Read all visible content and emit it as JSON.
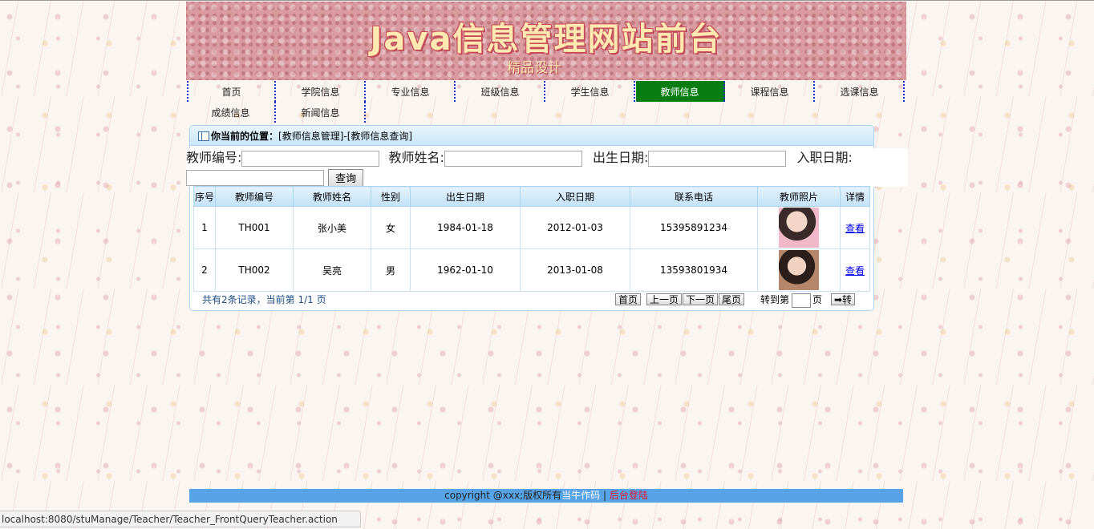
{
  "banner": {
    "title": "Java信息管理网站前台",
    "subtitle": "精品设计"
  },
  "nav": {
    "row1": [
      "首页",
      "学院信息",
      "专业信息",
      "班级信息",
      "学生信息",
      "教师信息",
      "课程信息",
      "选课信息"
    ],
    "row2": [
      "成绩信息",
      "新闻信息"
    ],
    "active": "教师信息"
  },
  "breadcrumb": {
    "label": "你当前的位置：",
    "path": "[教师信息管理]-[教师信息查询]"
  },
  "search": {
    "teacher_no_label": "教师编号:",
    "teacher_name_label": "教师姓名:",
    "birth_label": "出生日期:",
    "hire_label": "入职日期:",
    "query_button": "查询"
  },
  "table": {
    "headers": [
      "序号",
      "教师编号",
      "教师姓名",
      "性别",
      "出生日期",
      "入职日期",
      "联系电话",
      "教师照片",
      "详情"
    ],
    "rows": [
      {
        "index": "1",
        "no": "TH001",
        "name": "张小美",
        "gender": "女",
        "birth": "1984-01-18",
        "hire": "2012-01-03",
        "phone": "15395891234",
        "detail": "查看"
      },
      {
        "index": "2",
        "no": "TH002",
        "name": "吴亮",
        "gender": "男",
        "birth": "1962-01-10",
        "hire": "2013-01-08",
        "phone": "13593801934",
        "detail": "查看"
      }
    ]
  },
  "pager": {
    "info": "共有2条记录，当前第 1/1 页",
    "first": "首页",
    "prev": "上一页",
    "next": "下一页",
    "last": "尾页",
    "goto_label": "转到第",
    "page_suffix": "页",
    "go_button": "➡转"
  },
  "footer": {
    "copyright": "copyright @xxx;版权所有",
    "author": "当牛作码",
    "separator": " | ",
    "admin_login": "后台登陆"
  },
  "status_bar": {
    "url": "localhost:8080/stuManage/Teacher/Teacher_FrontQueryTeacher.action"
  },
  "colors": {
    "nav_active": "#0a7d12",
    "footer_bg": "#57a3e8",
    "admin_link": "#e8132a"
  }
}
